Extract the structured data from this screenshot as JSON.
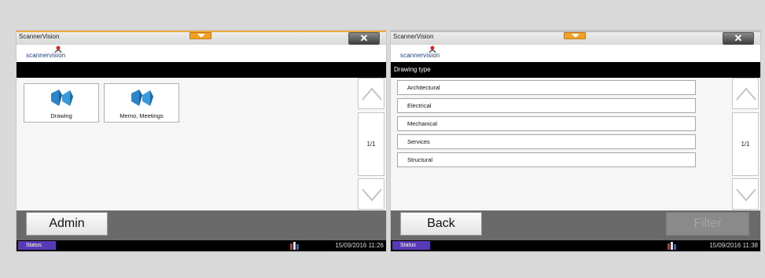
{
  "left": {
    "window_title": "ScannerVision",
    "close_label": "✕",
    "logo_text": "scannervision",
    "header_text": "",
    "tiles": [
      {
        "label": "Drawing",
        "icon": "folder-blue-icon"
      },
      {
        "label": "Memo, Meetings",
        "icon": "folder-blue-icon"
      }
    ],
    "page_indicator": "1/1",
    "footer_button": "Admin",
    "status_label": "Status",
    "datetime": "15/09/2016 11:26"
  },
  "right": {
    "window_title": "ScannerVision",
    "close_label": "✕",
    "logo_text": "scannervision",
    "header_text": "Drawing type",
    "items": [
      "Architectural",
      "Electrical",
      "Mechanical",
      "Services",
      "Structural"
    ],
    "page_indicator": "1/1",
    "back_button": "Back",
    "filter_button": "Filter",
    "status_label": "Status",
    "datetime": "15/09/2016 11:38"
  },
  "colors": {
    "accent_orange": "#f2a125",
    "status_purple": "#5a39b8",
    "logo_blue": "#1c3e8a"
  }
}
